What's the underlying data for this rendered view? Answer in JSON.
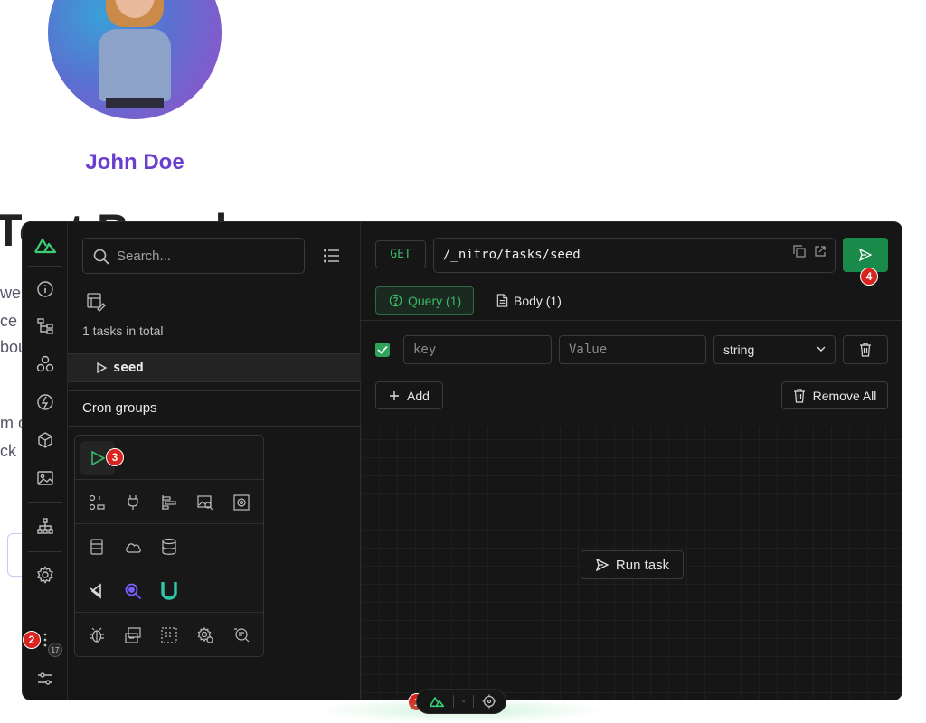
{
  "profile": {
    "name": "John Doe"
  },
  "background_page": {
    "heading_fragment": "Test Board",
    "text_lines": [
      "wel",
      "ce",
      "bou",
      "m c",
      "ck"
    ]
  },
  "search": {
    "placeholder": "Search..."
  },
  "tasks": {
    "total_label": "1 tasks in total",
    "items": [
      {
        "name": "seed"
      }
    ],
    "cron_groups_label": "Cron groups"
  },
  "request": {
    "method": "GET",
    "url": "/_nitro/tasks/seed",
    "tabs": [
      {
        "label": "Query (1)",
        "active": true
      },
      {
        "label": "Body (1)",
        "active": false
      }
    ],
    "query_row": {
      "key_placeholder": "key",
      "value_placeholder": "Value",
      "type": "string",
      "checked": true
    },
    "add_label": "Add",
    "remove_all_label": "Remove All",
    "run_task_label": "Run task"
  },
  "badges": {
    "b1": "1",
    "b2": "2",
    "b3": "3",
    "b4": "4",
    "more_count": "17"
  },
  "colors": {
    "accent_green": "#39b866",
    "send_button": "#1a8a4a",
    "badge_red": "#d9231f",
    "profile_name": "#6a3fd0",
    "panel_bg": "#161616"
  },
  "sidebar_icons": [
    "nuxt-logo",
    "info-icon",
    "components-tree-icon",
    "modules-icon",
    "hooks-icon",
    "payload-icon",
    "assets-icon",
    "routes-tree-icon",
    "settings-icon",
    "more-icon",
    "sliders-icon"
  ]
}
